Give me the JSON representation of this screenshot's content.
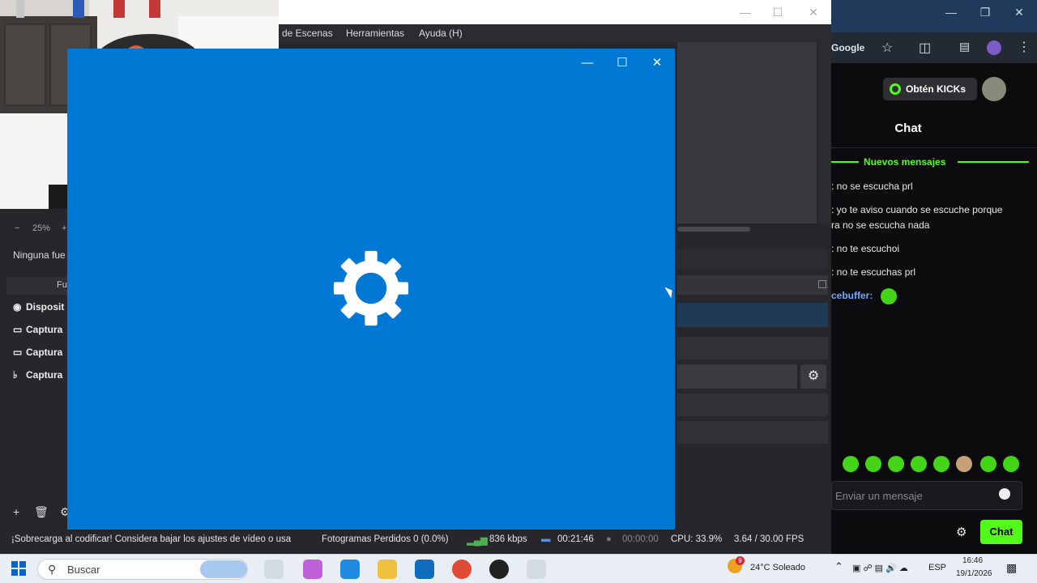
{
  "obs": {
    "menu": {
      "scenes": "de Escenas",
      "tools": "Herramientas",
      "help": "Ayuda (H)"
    },
    "sources": {
      "zoom": "25%",
      "no_source": "Ninguna fue",
      "header": "Fu",
      "items": [
        "Disposit",
        "Captura",
        "Captura",
        "Captura"
      ]
    },
    "statusbar": {
      "warning": "¡Sobrecarga al codificar! Considera bajar los ajustes de vídeo o usa",
      "dropped_frames": "Fotogramas Perdidos 0 (0.0%)",
      "bitrate": "836 kbps",
      "stream_time": "00:21:46",
      "record_time": "00:00:00",
      "cpu": "CPU: 33.9%",
      "fps": "3.64 / 30.00 FPS"
    }
  },
  "browser": {
    "toolbar_label": "Google",
    "kicks_button": "Obtén KICKs",
    "chat_title": "Chat",
    "new_messages": "Nuevos mensajes",
    "messages": [
      ": no se escucha prl",
      ": yo te aviso cuando se escuche porque",
      "ra no se escucha nada",
      ": no te escuchoi",
      ": no te escuchas prl"
    ],
    "last_user": "cebuffer:",
    "input_placeholder": "Enviar un mensaje",
    "send_button": "Chat",
    "accent_color": "#53fc18"
  },
  "taskbar": {
    "search_placeholder": "Buscar",
    "weather": "24°C  Soleado",
    "lang": "ESP",
    "time": "16:46",
    "date": "19/1/2026",
    "notification_badge": "9"
  },
  "splash": {
    "background": "#0078d4",
    "icon": "gear-icon"
  }
}
